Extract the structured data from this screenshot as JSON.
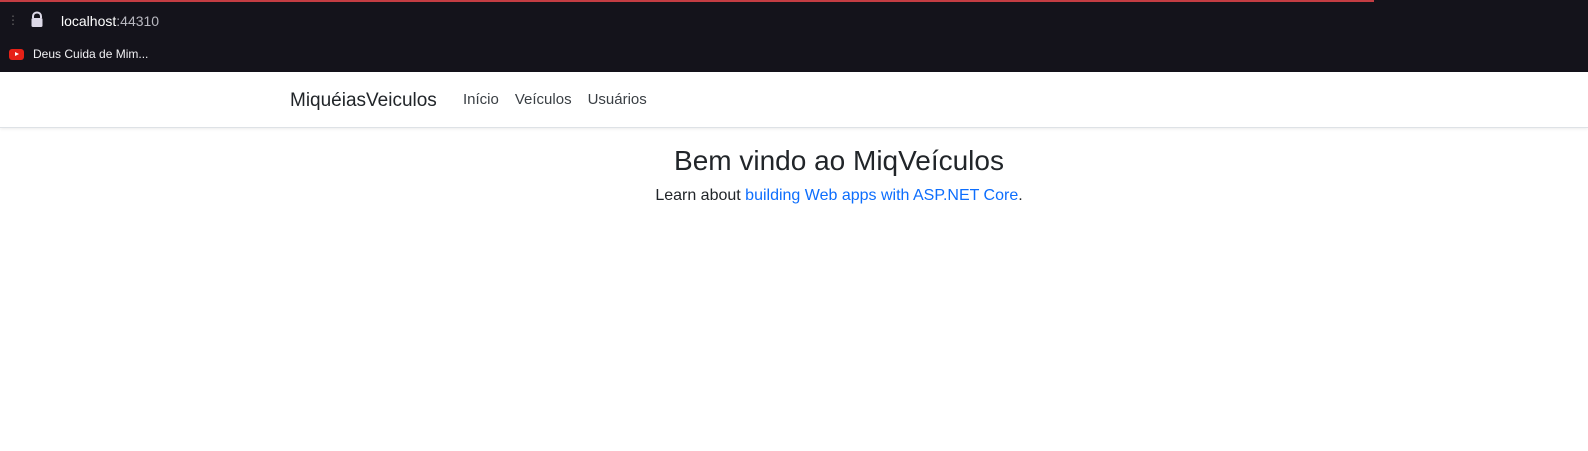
{
  "browser": {
    "url_host": "localhost",
    "url_port": ":44310",
    "bookmark_label": "Deus Cuida de Mim..."
  },
  "navbar": {
    "brand": "MiquéiasVeiculos",
    "links": [
      {
        "label": "Início"
      },
      {
        "label": "Veículos"
      },
      {
        "label": "Usuários"
      }
    ]
  },
  "welcome": {
    "title": "Bem vindo ao MiqVeículos",
    "text_prefix": "Learn about ",
    "link_text": "building Web apps with ASP.NET Core",
    "text_suffix": "."
  },
  "colors": {
    "browser_background": "#14131b",
    "browser_top_accent": "#c43d43",
    "link": "#0d6efd",
    "text": "#212529"
  },
  "icons": {
    "lock": "lock-icon",
    "bookmark": "youtube-icon",
    "menu": "kebab-menu-icon"
  }
}
